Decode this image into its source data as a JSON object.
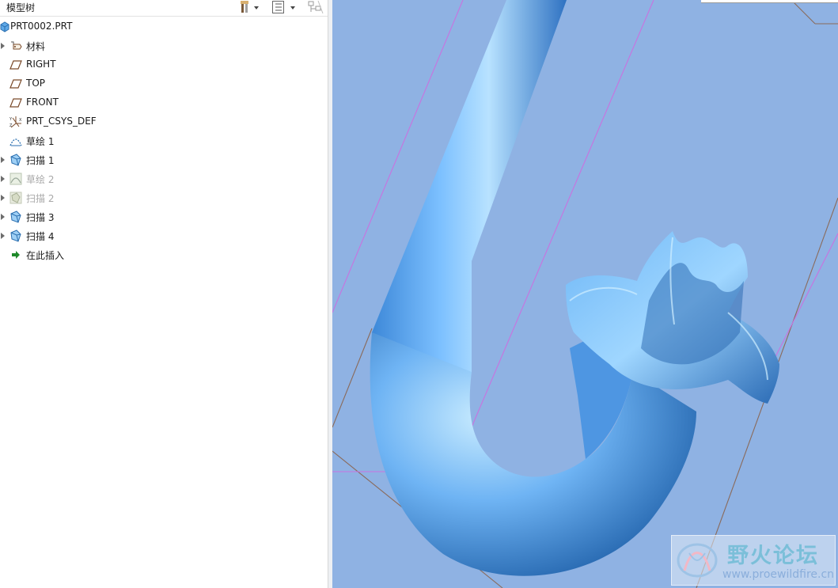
{
  "panel": {
    "title": "模型树"
  },
  "tree": {
    "items": [
      {
        "label": "PRT0002.PRT",
        "icon": "part-icon",
        "expander": false,
        "dim": false
      },
      {
        "label": "材料",
        "icon": "material-icon",
        "expander": true,
        "dim": false
      },
      {
        "label": "RIGHT",
        "icon": "datum-plane-icon",
        "expander": false,
        "dim": false
      },
      {
        "label": "TOP",
        "icon": "datum-plane-icon",
        "expander": false,
        "dim": false
      },
      {
        "label": "FRONT",
        "icon": "datum-plane-icon",
        "expander": false,
        "dim": false
      },
      {
        "label": "PRT_CSYS_DEF",
        "icon": "csys-icon",
        "expander": false,
        "dim": false
      },
      {
        "label": "草绘 1",
        "icon": "sketch-icon",
        "expander": false,
        "dim": false
      },
      {
        "label": "扫描 1",
        "icon": "sweep-icon",
        "expander": true,
        "dim": false
      },
      {
        "label": "草绘 2",
        "icon": "sketch-icon",
        "expander": true,
        "dim": true
      },
      {
        "label": "扫描 2",
        "icon": "sweep-icon",
        "expander": true,
        "dim": true
      },
      {
        "label": "扫描 3",
        "icon": "sweep-icon",
        "expander": true,
        "dim": false
      },
      {
        "label": "扫描 4",
        "icon": "sweep-icon",
        "expander": true,
        "dim": false
      },
      {
        "label": "在此插入",
        "icon": "insert-here-arrow-icon",
        "expander": false,
        "dim": false
      }
    ]
  },
  "watermark": {
    "title": "野火论坛",
    "url": "www.proewildfire.cn"
  },
  "colors": {
    "viewport_bg": "#8fb2e3",
    "model_blue": "#5aa8f2",
    "datum_magenta": "#c873e0",
    "datum_brown": "#8a6a5a"
  }
}
